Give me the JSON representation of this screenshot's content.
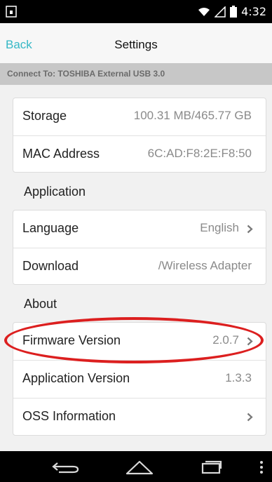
{
  "status_bar": {
    "time": "4:32",
    "icons": [
      "notification-icon",
      "wifi-icon",
      "signal-icon",
      "battery-icon"
    ]
  },
  "header": {
    "back_label": "Back",
    "title": "Settings"
  },
  "connection": {
    "text": "Connect To: TOSHIBA  External USB 3.0"
  },
  "device_info": [
    {
      "label": "Storage",
      "value": "100.31 MB/465.77 GB"
    },
    {
      "label": "MAC Address",
      "value": "6C:AD:F8:2E:F8:50"
    }
  ],
  "application": {
    "heading": "Application",
    "items": [
      {
        "label": "Language",
        "value": "English"
      },
      {
        "label": "Download",
        "value": "/Wireless Adapter"
      }
    ]
  },
  "about": {
    "heading": "About",
    "items": [
      {
        "label": "Firmware Version",
        "value": "2.0.7"
      },
      {
        "label": "Application Version",
        "value": "1.3.3"
      },
      {
        "label": "OSS Information",
        "value": ""
      }
    ]
  },
  "colors": {
    "accent": "#36b8c6",
    "annotation": "#dc1f1f"
  },
  "nav_buttons": [
    "back-icon",
    "home-icon",
    "recent-apps-icon",
    "menu-icon"
  ]
}
